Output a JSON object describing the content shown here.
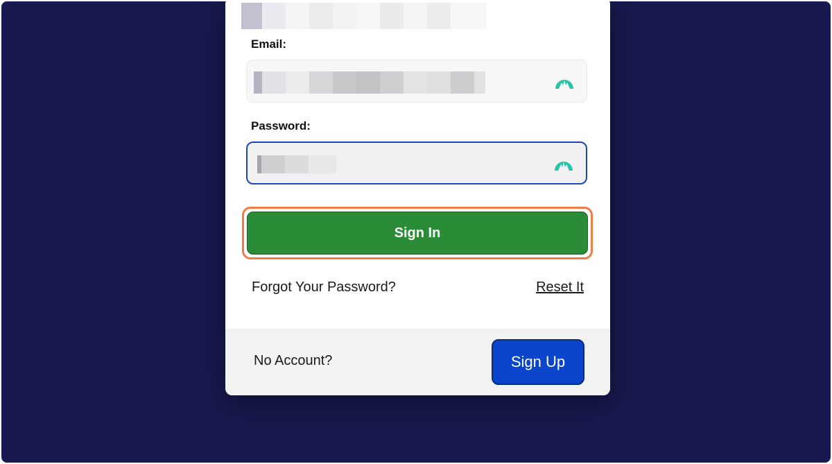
{
  "form": {
    "email_label": "Email:",
    "password_label": "Password:",
    "signin_label": "Sign In",
    "forgot_text": "Forgot Your Password?",
    "reset_label": "Reset It"
  },
  "footer": {
    "no_account_text": "No Account?",
    "signup_label": "Sign Up"
  },
  "icons": {
    "password_manager": "nordpass-icon"
  },
  "colors": {
    "background": "#181a4f",
    "signin_button": "#2b8c37",
    "signup_button": "#0a45cc",
    "highlight_ring": "#f27d43",
    "focus_border": "#1b48b5",
    "icon_teal": "#2ac3a6"
  }
}
